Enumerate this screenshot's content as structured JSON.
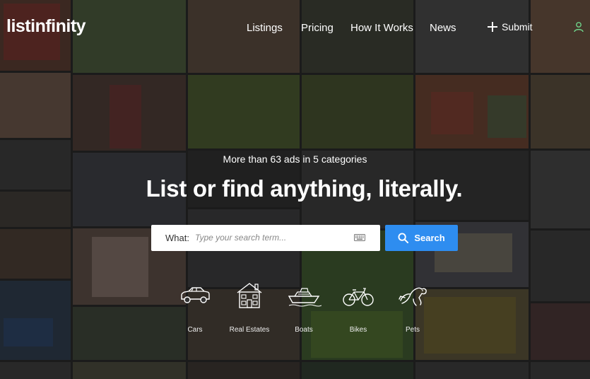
{
  "header": {
    "logo": "listinfinity",
    "nav": [
      {
        "label": "Listings"
      },
      {
        "label": "Pricing"
      },
      {
        "label": "How It Works"
      },
      {
        "label": "News"
      }
    ],
    "submit_label": "Submit"
  },
  "hero": {
    "tagline": "More than 63 ads in 5 categories",
    "headline": "List or find anything, literally."
  },
  "search": {
    "what_label": "What:",
    "placeholder": "Type your search term...",
    "button_label": "Search"
  },
  "categories": [
    {
      "label": "Cars",
      "icon": "car-icon"
    },
    {
      "label": "Real Estates",
      "icon": "house-icon"
    },
    {
      "label": "Boats",
      "icon": "boat-icon"
    },
    {
      "label": "Bikes",
      "icon": "bike-icon"
    },
    {
      "label": "Pets",
      "icon": "pet-icon"
    }
  ],
  "colors": {
    "accent": "#2e8df0"
  }
}
